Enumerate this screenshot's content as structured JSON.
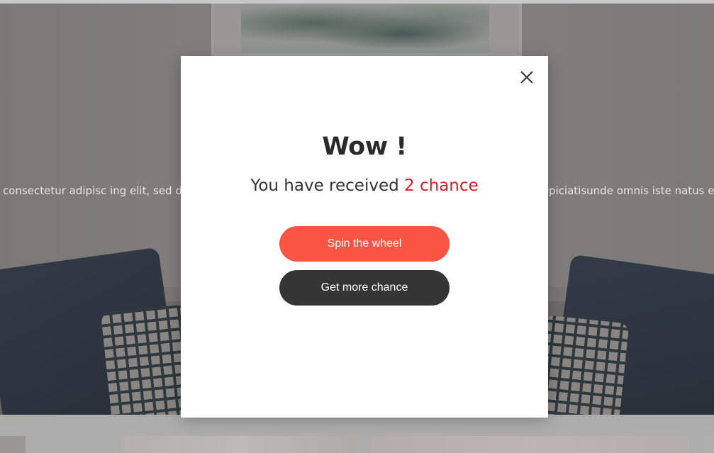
{
  "background": {
    "text_left": "consectetur adipisc ing elit, sed do",
    "text_right": "piciatisunde omnis iste natus err"
  },
  "modal": {
    "close_icon": "close-icon",
    "title": "Wow !",
    "subtitle_prefix": "You have received ",
    "subtitle_highlight": "2 chance",
    "spin_label": "Spin the wheel",
    "more_label": "Get more chance"
  },
  "colors": {
    "accent_text": "#d31f26",
    "spin_button": "#fa5445",
    "more_button": "#353535"
  }
}
